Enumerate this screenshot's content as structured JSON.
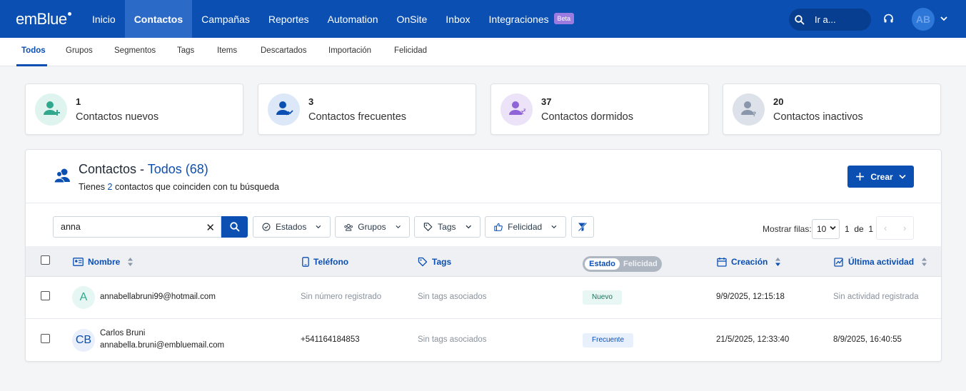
{
  "brand": {
    "logo": "emBlue",
    "primary_color": "#0b4fb3"
  },
  "topnav": {
    "items": [
      {
        "label": "Inicio"
      },
      {
        "label": "Contactos"
      },
      {
        "label": "Campañas"
      },
      {
        "label": "Reportes"
      },
      {
        "label": "Automation"
      },
      {
        "label": "OnSite"
      },
      {
        "label": "Inbox"
      },
      {
        "label": "Integraciones"
      }
    ],
    "active": "Contactos",
    "beta_label": "Beta",
    "goto_placeholder": "Ir a...",
    "user_initials": "AB"
  },
  "subnav": {
    "items": [
      "Todos",
      "Grupos",
      "Segmentos",
      "Tags",
      "Items",
      "Descartados",
      "Importación",
      "Felicidad"
    ],
    "active": "Todos"
  },
  "stats": [
    {
      "count": "1",
      "label": "Contactos nuevos",
      "icon": "user-add-icon",
      "color": "#2fa88e"
    },
    {
      "count": "3",
      "label": "Contactos frecuentes",
      "icon": "user-trend-icon",
      "color": "#0b4fb3"
    },
    {
      "count": "37",
      "label": "Contactos dormidos",
      "icon": "user-sleep-icon",
      "color": "#8e64d6"
    },
    {
      "count": "20",
      "label": "Contactos inactivos",
      "icon": "user-question-icon",
      "color": "#8a97ab"
    }
  ],
  "panel": {
    "title_prefix": "Contactos - ",
    "title_segment": "Todos",
    "title_count": "(68)",
    "subtitle_before": "Tienes ",
    "subtitle_count": "2",
    "subtitle_after": " contactos que coinciden con tu búsqueda",
    "create_label": "Crear"
  },
  "filters": {
    "search_value": "anna",
    "buttons": [
      "Estados",
      "Grupos",
      "Tags",
      "Felicidad"
    ],
    "rows_label": "Mostrar filas:",
    "rows_value": "10",
    "page_current": "1",
    "page_of": "de",
    "page_total": "1"
  },
  "table": {
    "headers": {
      "name": "Nombre",
      "phone": "Teléfono",
      "tags": "Tags",
      "toggle_on": "Estado",
      "toggle_off": "Felicidad",
      "created": "Creación",
      "last_activity": "Última actividad"
    },
    "rows": [
      {
        "initials": "A",
        "name": "",
        "email": "annabellabruni99@hotmail.com",
        "phone": "Sin número registrado",
        "tags": "Sin tags asociados",
        "status": "Nuevo",
        "created": "9/9/2025, 12:15:18",
        "last_activity": "Sin actividad registrada"
      },
      {
        "initials": "CB",
        "name": "Carlos Bruni",
        "email": "annabella.bruni@embluemail.com",
        "phone": "+541164184853",
        "tags": "Sin tags asociados",
        "status": "Frecuente",
        "created": "21/5/2025, 12:33:40",
        "last_activity": "8/9/2025, 16:40:55"
      }
    ]
  }
}
